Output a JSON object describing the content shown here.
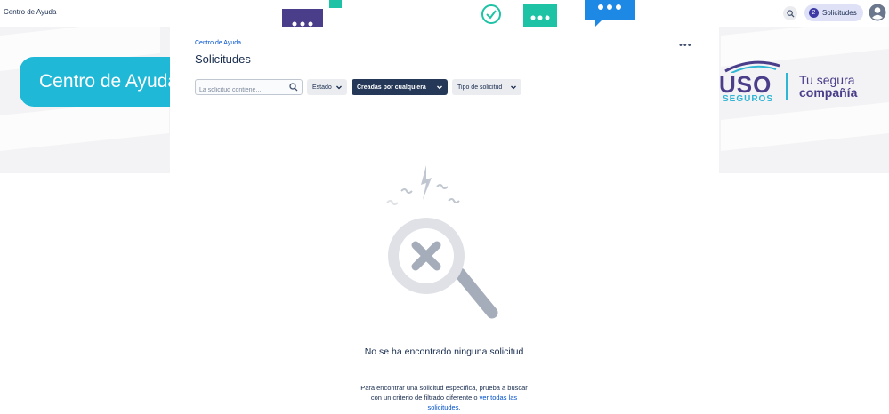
{
  "header": {
    "brand": "Centro de Ayuda",
    "requests_count": "2",
    "requests_label": "Solicitudes"
  },
  "banner": {
    "pill_text": "Centro de Ayuda",
    "logo_main": "USO",
    "logo_sub": "SEGUROS",
    "logo_tag_1": "Tu segura",
    "logo_tag_2": "compañía",
    "colors": {
      "pill": "#1fb8d7",
      "logo_purple": "#4a3e8a",
      "logo_cyan": "#2fb6d4"
    }
  },
  "main": {
    "breadcrumb": "Centro de Ayuda",
    "title": "Solicitudes",
    "more_label": "•••",
    "filters": {
      "search_placeholder": "La solicitud contiene...",
      "search_value": "",
      "estado_label": "Estado",
      "creadas_label": "Creadas por cualquiera",
      "tipo_label": "Tipo de solicitud"
    },
    "empty": {
      "title": "No se ha encontrado ninguna solicitud",
      "description": "Para encontrar una solicitud específica, prueba a buscar con un criterio de filtrado diferente o",
      "link": "ver todas las solicitudes."
    }
  },
  "icons": [
    "search-icon",
    "user-avatar-icon",
    "more-icon",
    "chevron-down-icon",
    "empty-search-illustration",
    "chat-bubble-icon",
    "check-circle-icon"
  ]
}
